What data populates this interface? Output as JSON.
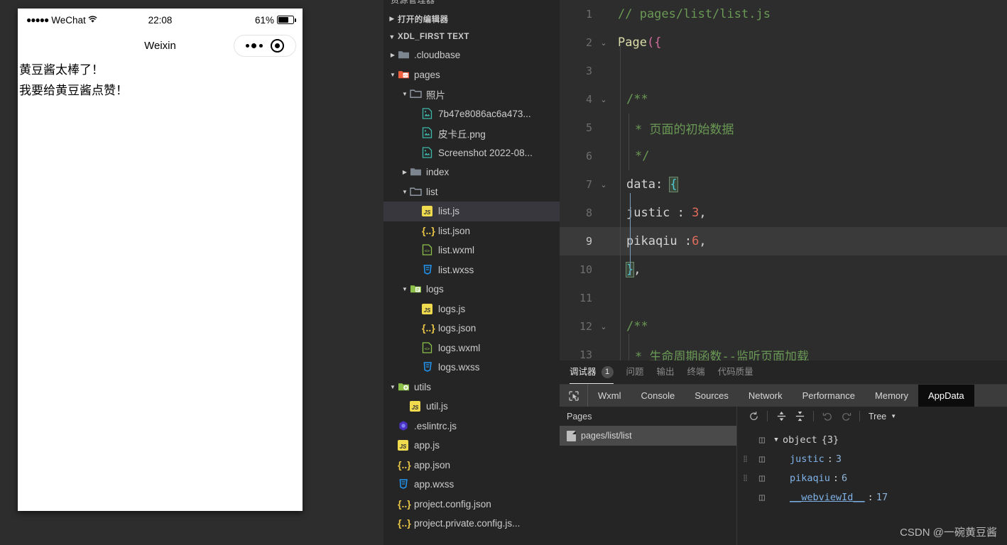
{
  "simulator": {
    "status_bar": {
      "signal_dots": "●●●●●",
      "carrier": "WeChat",
      "wifi_icon": "wifi-icon",
      "time": "22:08",
      "battery_percent": "61%",
      "battery_level": 61
    },
    "nav": {
      "title": "Weixin",
      "capsule_menu_icon": "more-dots-icon",
      "capsule_close_icon": "target-circle-icon"
    },
    "page_content": [
      "黄豆酱太棒了！",
      "我要给黄豆酱点赞！"
    ]
  },
  "explorer": {
    "clipped_header": "资源管理器",
    "open_editors_label": "打开的编辑器",
    "project_label": "XDL_FIRST TEXT",
    "tree": [
      {
        "label": ".cloudbase",
        "icon": "folder-icon",
        "indent": 1,
        "twisty": "right",
        "selected": false
      },
      {
        "label": "pages",
        "icon": "folder-pages-icon",
        "indent": 1,
        "twisty": "down",
        "selected": false
      },
      {
        "label": "照片",
        "icon": "folder-open-icon",
        "indent": 2,
        "twisty": "down",
        "selected": false
      },
      {
        "label": "7b47e8086ac6a473...",
        "icon": "image-icon",
        "indent": 3,
        "twisty": "none",
        "selected": false
      },
      {
        "label": "皮卡丘.png",
        "icon": "image-icon",
        "indent": 3,
        "twisty": "none",
        "selected": false
      },
      {
        "label": "Screenshot 2022-08...",
        "icon": "image-icon",
        "indent": 3,
        "twisty": "none",
        "selected": false
      },
      {
        "label": "index",
        "icon": "folder-icon",
        "indent": 2,
        "twisty": "right",
        "selected": false
      },
      {
        "label": "list",
        "icon": "folder-open-icon",
        "indent": 2,
        "twisty": "down",
        "selected": false
      },
      {
        "label": "list.js",
        "icon": "js-icon",
        "indent": 3,
        "twisty": "none",
        "selected": true
      },
      {
        "label": "list.json",
        "icon": "json-icon",
        "indent": 3,
        "twisty": "none",
        "selected": false
      },
      {
        "label": "list.wxml",
        "icon": "wxml-icon",
        "indent": 3,
        "twisty": "none",
        "selected": false
      },
      {
        "label": "list.wxss",
        "icon": "wxss-icon",
        "indent": 3,
        "twisty": "none",
        "selected": false
      },
      {
        "label": "logs",
        "icon": "folder-logs-icon",
        "indent": 2,
        "twisty": "down",
        "selected": false
      },
      {
        "label": "logs.js",
        "icon": "js-icon",
        "indent": 3,
        "twisty": "none",
        "selected": false
      },
      {
        "label": "logs.json",
        "icon": "json-icon",
        "indent": 3,
        "twisty": "none",
        "selected": false
      },
      {
        "label": "logs.wxml",
        "icon": "wxml-icon",
        "indent": 3,
        "twisty": "none",
        "selected": false
      },
      {
        "label": "logs.wxss",
        "icon": "wxss-icon",
        "indent": 3,
        "twisty": "none",
        "selected": false
      },
      {
        "label": "utils",
        "icon": "folder-utils-icon",
        "indent": 1,
        "twisty": "down",
        "selected": false
      },
      {
        "label": "util.js",
        "icon": "js-icon",
        "indent": 2,
        "twisty": "none",
        "selected": false
      },
      {
        "label": ".eslintrc.js",
        "icon": "eslint-icon",
        "indent": 1,
        "twisty": "none",
        "selected": false
      },
      {
        "label": "app.js",
        "icon": "js-icon",
        "indent": 1,
        "twisty": "none",
        "selected": false
      },
      {
        "label": "app.json",
        "icon": "json-icon",
        "indent": 1,
        "twisty": "none",
        "selected": false
      },
      {
        "label": "app.wxss",
        "icon": "wxss-icon",
        "indent": 1,
        "twisty": "none",
        "selected": false
      },
      {
        "label": "project.config.json",
        "icon": "json-icon",
        "indent": 1,
        "twisty": "none",
        "selected": false
      },
      {
        "label": "project.private.config.js...",
        "icon": "json-icon",
        "indent": 1,
        "twisty": "none",
        "selected": false
      }
    ]
  },
  "editor": {
    "active_line": 9,
    "lines": [
      {
        "n": "1",
        "fold": "",
        "tokens": [
          {
            "t": "// pages/list/list.js",
            "c": "c-comment",
            "indent": 0
          }
        ]
      },
      {
        "n": "2",
        "fold": "v",
        "tokens": [
          {
            "t": "Page",
            "c": "c-fn",
            "indent": 0
          },
          {
            "t": "(",
            "c": "c-paren"
          },
          {
            "t": "{",
            "c": "c-paren"
          }
        ]
      },
      {
        "n": "3",
        "fold": "",
        "tokens": []
      },
      {
        "n": "4",
        "fold": "v",
        "tokens": [
          {
            "t": "/**",
            "c": "c-comment",
            "indent": 1
          }
        ]
      },
      {
        "n": "5",
        "fold": "",
        "tokens": [
          {
            "t": "* 页面的初始数据",
            "c": "c-comment",
            "indent": 2
          }
        ]
      },
      {
        "n": "6",
        "fold": "",
        "tokens": [
          {
            "t": "*/",
            "c": "c-comment",
            "indent": 2
          }
        ]
      },
      {
        "n": "7",
        "fold": "v",
        "tokens": [
          {
            "t": "data: ",
            "c": "c-plain",
            "indent": 1
          },
          {
            "t": "{",
            "c": "c-brace",
            "box": true
          }
        ]
      },
      {
        "n": "8",
        "fold": "",
        "tokens": [
          {
            "t": "justic : ",
            "c": "c-plain",
            "indent": 1
          },
          {
            "t": "3",
            "c": "c-num"
          },
          {
            "t": ",",
            "c": "c-plain"
          }
        ]
      },
      {
        "n": "9",
        "fold": "",
        "tokens": [
          {
            "t": "pikaqiu :",
            "c": "c-plain",
            "indent": 1
          },
          {
            "t": "6",
            "c": "c-num"
          },
          {
            "t": ",",
            "c": "c-plain"
          }
        ]
      },
      {
        "n": "10",
        "fold": "",
        "tokens": [
          {
            "t": "}",
            "c": "c-brace",
            "indent": 1,
            "box": true
          },
          {
            "t": ",",
            "c": "c-plain"
          }
        ]
      },
      {
        "n": "11",
        "fold": "",
        "tokens": []
      },
      {
        "n": "12",
        "fold": "v",
        "tokens": [
          {
            "t": "/**",
            "c": "c-comment",
            "indent": 1
          }
        ]
      },
      {
        "n": "13",
        "fold": "",
        "tokens": [
          {
            "t": "* 生命周期函数--监听页面加载",
            "c": "c-comment",
            "indent": 2
          }
        ]
      }
    ]
  },
  "panel": {
    "tabs": [
      {
        "label": "调试器",
        "badge": "1",
        "active": true
      },
      {
        "label": "问题",
        "badge": "",
        "active": false
      },
      {
        "label": "输出",
        "badge": "",
        "active": false
      },
      {
        "label": "终端",
        "badge": "",
        "active": false
      },
      {
        "label": "代码质量",
        "badge": "",
        "active": false
      }
    ],
    "devtools_tabs": [
      {
        "label": "Wxml",
        "active": false
      },
      {
        "label": "Console",
        "active": false
      },
      {
        "label": "Sources",
        "active": false
      },
      {
        "label": "Network",
        "active": false
      },
      {
        "label": "Performance",
        "active": false
      },
      {
        "label": "Memory",
        "active": false
      },
      {
        "label": "AppData",
        "active": true
      }
    ],
    "inspect_icon": "cursor-select-icon",
    "pages": {
      "header": "Pages",
      "items": [
        {
          "label": "pages/list/list",
          "selected": true,
          "icon": "file-icon"
        }
      ]
    },
    "toolbar": {
      "refresh_icon": "refresh-icon",
      "expand_icon": "expand-all-icon",
      "collapse_icon": "collapse-all-icon",
      "undo_icon": "undo-icon",
      "redo_icon": "redo-icon",
      "view_mode": "Tree",
      "view_mode_caret": "chevron-down-icon"
    },
    "appdata": {
      "root_label": "object",
      "root_count": "{3}",
      "rows": [
        {
          "key": "justic",
          "value": "3",
          "underline": false,
          "draggable": true
        },
        {
          "key": "pikaqiu",
          "value": "6",
          "underline": false,
          "draggable": true
        },
        {
          "key": "__webviewId__",
          "value": "17",
          "underline": true,
          "draggable": false
        }
      ]
    }
  },
  "watermark": "CSDN @一碗黄豆酱",
  "colors": {
    "editor_bg": "#2d2d2d",
    "sidebar_bg": "#252526",
    "selection_bg": "#37373d",
    "devtab_active_bg": "#0c0c0c",
    "comment_green": "#6A9955",
    "number_red": "#e06c5b",
    "function_yellow": "#DCDCAA",
    "json_key_blue": "#7fb3e8"
  }
}
